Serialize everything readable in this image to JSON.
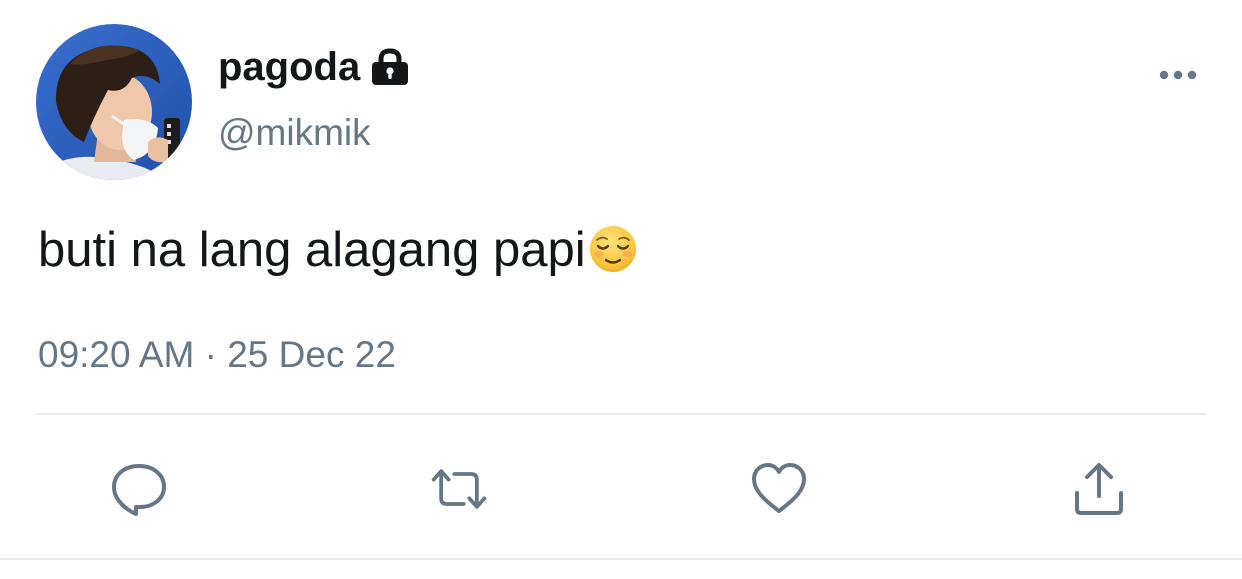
{
  "user": {
    "display_name": "pagoda",
    "handle": "@mikmik",
    "protected_icon": "lock-icon",
    "avatar": "profile-photo"
  },
  "tweet": {
    "text": "buti na lang alagang papi",
    "emoji": "relieved-face-icon",
    "time": "09:20 AM",
    "separator": "·",
    "date": "25 Dec 22"
  },
  "actions": [
    {
      "name": "reply",
      "icon": "reply-icon"
    },
    {
      "name": "retweet",
      "icon": "retweet-icon"
    },
    {
      "name": "like",
      "icon": "heart-icon"
    },
    {
      "name": "share",
      "icon": "share-icon"
    }
  ],
  "colors": {
    "text_primary": "#14171a",
    "text_secondary": "#657786",
    "divider": "#e6ecf0",
    "avatar_sky": "#2f63c2"
  }
}
